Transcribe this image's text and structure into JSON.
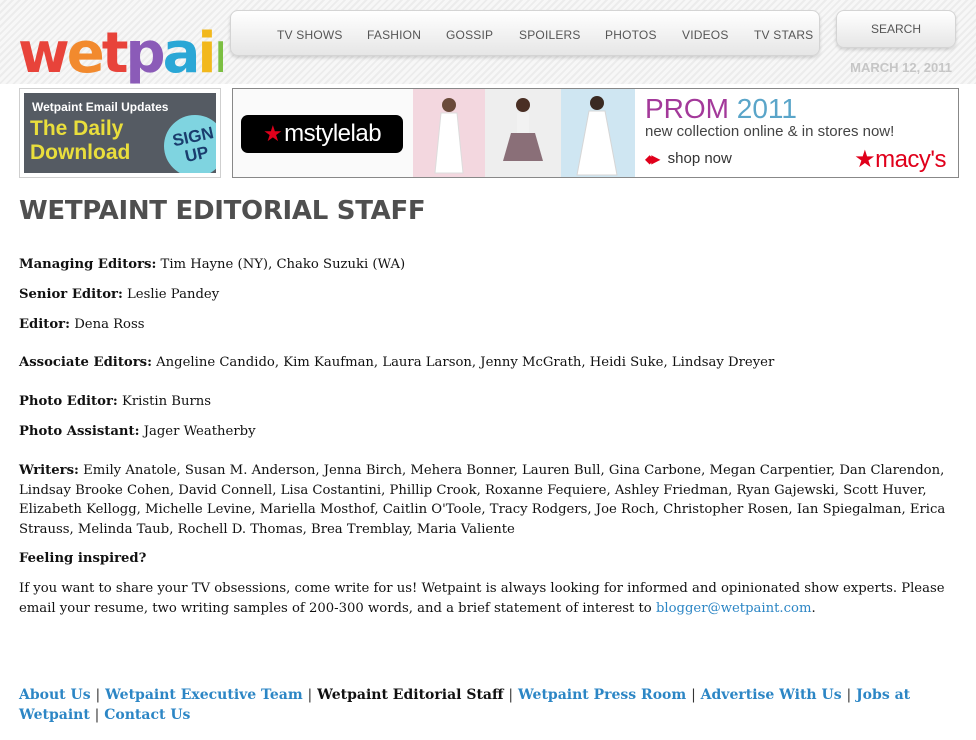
{
  "logo": {
    "text": "wetpaint"
  },
  "nav": {
    "tabs": [
      "TV SHOWS",
      "FASHION",
      "GOSSIP",
      "SPOILERS",
      "PHOTOS",
      "VIDEOS",
      "TV STARS"
    ],
    "search_label": "SEARCH"
  },
  "date": "MARCH 12, 2011",
  "promo": {
    "top": "Wetpaint Email Updates",
    "title": "The Daily Download",
    "signup_line1": "SIGN",
    "signup_line2": "UP"
  },
  "ad": {
    "brand": "mstylelab",
    "prom": "PROM",
    "year": "2011",
    "subtitle": "new collection online & in stores now!",
    "shop": "shop now",
    "store": "macy's"
  },
  "page_title": "WETPAINT EDITORIAL STAFF",
  "staff": [
    {
      "label": "Managing Editors:",
      "value": "Tim Hayne (NY), Chako Suzuki (WA)"
    },
    {
      "label": "Senior Editor:",
      "value": "Leslie Pandey"
    },
    {
      "label": "Editor:",
      "value": "Dena Ross"
    },
    {
      "label": "Associate Editors:",
      "value": "Angeline Candido, Kim Kaufman, Laura Larson, Jenny McGrath, Heidi Suke, Lindsay Dreyer"
    },
    {
      "label": "Photo Editor:",
      "value": "Kristin Burns"
    },
    {
      "label": "Photo Assistant:",
      "value": "Jager Weatherby"
    },
    {
      "label": "Writers:",
      "value": "Emily Anatole, Susan M. Anderson, Jenna Birch, Mehera Bonner, Lauren Bull, Gina Carbone, Megan Carpentier, Dan Clarendon, Lindsay Brooke Cohen, David Connell, Lisa Costantini, Phillip Crook, Roxanne Fequiere, Ashley Friedman, Ryan Gajewski, Scott Huver, Elizabeth Kellogg, Michelle Levine, Mariella Mosthof, Caitlin O'Toole, Tracy Rodgers, Joe Roch, Christopher Rosen, Ian Spiegalman, Erica Strauss, Melinda Taub, Rochell D. Thomas, Brea Tremblay, Maria Valiente"
    }
  ],
  "inspired": {
    "heading": "Feeling inspired?",
    "text": "If you want to share your TV obsessions, come write for us! Wetpaint is always looking for informed and opinionated show experts.  Please email your resume, two writing samples of 200-300 words, and a brief statement of interest to ",
    "email": "blogger@wetpaint.com",
    "end": "."
  },
  "footer": {
    "links": [
      "About Us",
      "Wetpaint Executive Team",
      "Wetpaint Editorial Staff",
      "Wetpaint Press Room",
      "Advertise With Us",
      "Jobs at Wetpaint",
      "Contact Us"
    ],
    "separator": "|"
  },
  "colors": {
    "link": "#2c86c5",
    "title": "#4f4f4f",
    "date": "#c6c6c6",
    "accent_red": "#e0001b"
  }
}
